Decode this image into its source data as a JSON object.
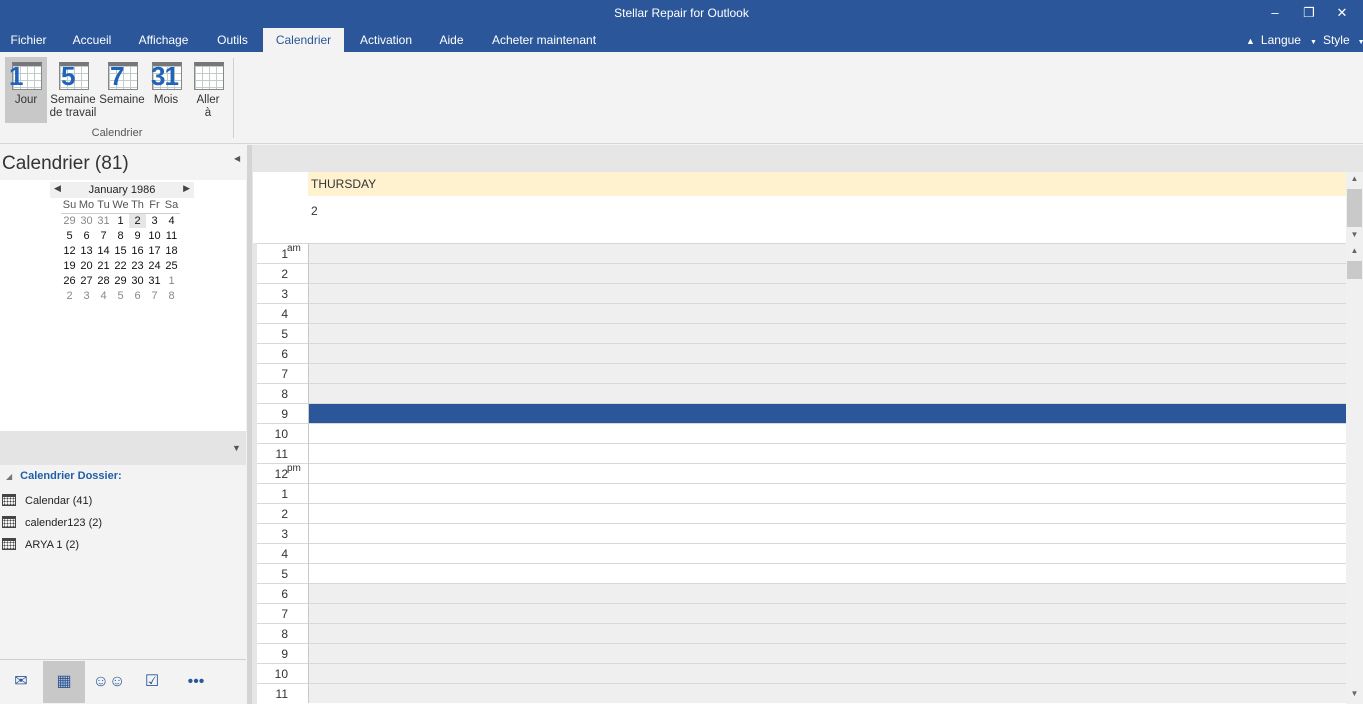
{
  "window": {
    "title": "Stellar Repair for Outlook",
    "minimize": "–",
    "restore": "❐",
    "close": "✕"
  },
  "menu": {
    "items": [
      "Fichier",
      "Accueil",
      "Affichage",
      "Outils",
      "Calendrier",
      "Activation",
      "Aide",
      "Acheter maintenant"
    ],
    "active": "Calendrier",
    "langue": "Langue",
    "style": "Style"
  },
  "ribbon": {
    "buttons": [
      {
        "num": "1",
        "label": "Jour"
      },
      {
        "num": "5",
        "label": "Semaine de travail"
      },
      {
        "num": "7",
        "label": "Semaine"
      },
      {
        "num": "31",
        "label": "Mois"
      },
      {
        "num": "",
        "label": "Aller à"
      }
    ],
    "group_label": "Calendrier"
  },
  "left": {
    "heading": "Calendrier (81)",
    "minical": {
      "month": "January 1986",
      "weekdays": [
        "Su",
        "Mo",
        "Tu",
        "We",
        "Th",
        "Fr",
        "Sa"
      ],
      "weeks": [
        [
          "29",
          "30",
          "31",
          "1",
          "2",
          "3",
          "4"
        ],
        [
          "5",
          "6",
          "7",
          "8",
          "9",
          "10",
          "11"
        ],
        [
          "12",
          "13",
          "14",
          "15",
          "16",
          "17",
          "18"
        ],
        [
          "19",
          "20",
          "21",
          "22",
          "23",
          "24",
          "25"
        ],
        [
          "26",
          "27",
          "28",
          "29",
          "30",
          "31",
          "1"
        ],
        [
          "2",
          "3",
          "4",
          "5",
          "6",
          "7",
          "8"
        ]
      ],
      "selected_day": "2"
    },
    "folders_header": "Calendrier Dossier:",
    "folders": [
      "Calendar (41)",
      "calender123 (2)",
      "ARYA 1 (2)"
    ]
  },
  "nav": {
    "icons": [
      "mail-icon",
      "calendar-icon",
      "people-icon",
      "tasks-icon",
      "more-icon"
    ],
    "selected": "calendar-icon"
  },
  "dayview": {
    "day_name": "THURSDAY",
    "day_number": "2",
    "hours": [
      "1",
      "2",
      "3",
      "4",
      "5",
      "6",
      "7",
      "8",
      "9",
      "10",
      "11",
      "12",
      "1",
      "2",
      "3",
      "4",
      "5",
      "6",
      "7",
      "8",
      "9",
      "10",
      "11"
    ],
    "am_label": "am",
    "pm_label": "pm",
    "selected_hour": "9"
  }
}
